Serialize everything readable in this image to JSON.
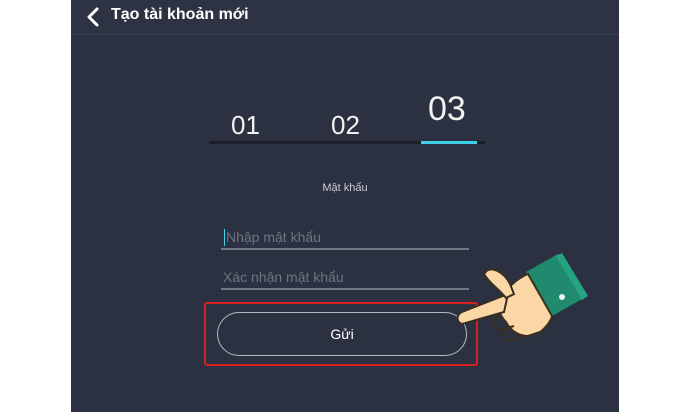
{
  "header": {
    "title": "Tạo tài khoản mới"
  },
  "steps": {
    "items": [
      "01",
      "02",
      "03"
    ],
    "active": "03"
  },
  "form": {
    "section_label": "Mật khẩu",
    "password_placeholder": "Nhập mật khẩu",
    "confirm_placeholder": "Xác nhận mật khẩu",
    "submit_label": "Gửi"
  },
  "colors": {
    "background": "#2b3140",
    "accent": "#3ed0e4",
    "highlight": "#d92020"
  },
  "icons": {
    "back": "chevron-left-icon",
    "pointer": "pointing-hand-icon"
  }
}
